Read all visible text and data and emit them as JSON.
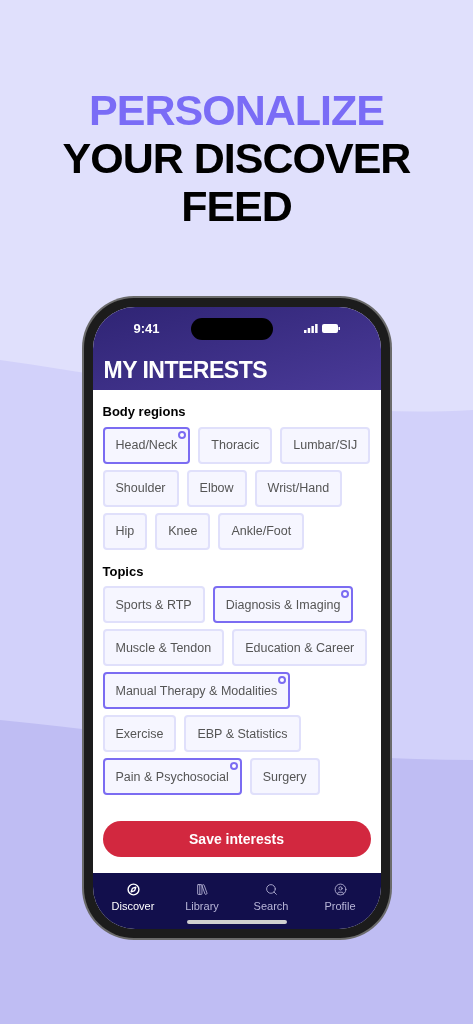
{
  "headline": [
    {
      "text": "PERSONALIZE",
      "highlight": true
    },
    {
      "text": "YOUR DISCOVER",
      "highlight": false
    },
    {
      "text": "FEED",
      "highlight": false
    }
  ],
  "status_bar": {
    "time": "9:41"
  },
  "title": "MY INTERESTS",
  "sections": [
    {
      "heading": "Body regions",
      "chips": [
        {
          "label": "Head/Neck",
          "selected": true
        },
        {
          "label": "Thoracic",
          "selected": false
        },
        {
          "label": "Lumbar/SIJ",
          "selected": false
        },
        {
          "label": "Shoulder",
          "selected": false
        },
        {
          "label": "Elbow",
          "selected": false
        },
        {
          "label": "Wrist/Hand",
          "selected": false
        },
        {
          "label": "Hip",
          "selected": false
        },
        {
          "label": "Knee",
          "selected": false
        },
        {
          "label": "Ankle/Foot",
          "selected": false
        }
      ]
    },
    {
      "heading": "Topics",
      "chips": [
        {
          "label": "Sports & RTP",
          "selected": false
        },
        {
          "label": "Diagnosis & Imaging",
          "selected": true
        },
        {
          "label": "Muscle & Tendon",
          "selected": false
        },
        {
          "label": "Education & Career",
          "selected": false
        },
        {
          "label": "Manual Therapy & Modalities",
          "selected": true
        },
        {
          "label": "Exercise",
          "selected": false
        },
        {
          "label": "EBP & Statistics",
          "selected": false
        },
        {
          "label": "Pain & Psychosocial",
          "selected": true
        },
        {
          "label": "Surgery",
          "selected": false
        }
      ]
    }
  ],
  "save_button": "Save interests",
  "tabs": [
    {
      "label": "Discover",
      "selected": true
    },
    {
      "label": "Library",
      "selected": false
    },
    {
      "label": "Search",
      "selected": false
    },
    {
      "label": "Profile",
      "selected": false
    }
  ]
}
